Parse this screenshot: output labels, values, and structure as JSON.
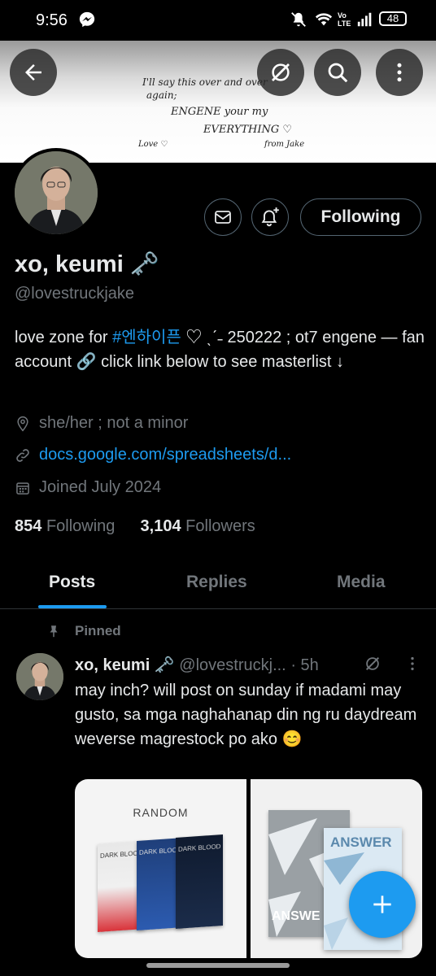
{
  "status_bar": {
    "time": "9:56",
    "battery": "48",
    "icons": [
      "messenger-icon",
      "mute-icon",
      "wifi-icon",
      "volte-icon",
      "signal-icon",
      "battery-icon"
    ]
  },
  "header": {
    "back_icon": "arrow-left-icon",
    "buttons": [
      "grok-icon",
      "search-icon",
      "more-vertical-icon"
    ]
  },
  "banner": {
    "lines": [
      "I'll say this over and over",
      "again;",
      "ENGENE   your  my",
      "EVERYTHING ♡",
      "Love ♡",
      "from Jake"
    ]
  },
  "profile": {
    "display_name": "xo, keumi",
    "name_emoji": "🗝️",
    "handle": "@lovestruckjake",
    "bio_pre": "love zone for ",
    "bio_hashtag": "#엔하이픈",
    "bio_post": " ♡ ˎˊ˗ 250222 ; ot7 engene — fan account 🔗 click link below to see masterlist ↓",
    "location": "she/her ; not a minor",
    "link": "docs.google.com/spreadsheets/d...",
    "joined": "Joined July 2024",
    "following_count": "854",
    "following_label": "Following",
    "followers_count": "3,104",
    "followers_label": "Followers",
    "following_button": "Following"
  },
  "tabs": [
    "Posts",
    "Replies",
    "Media"
  ],
  "post": {
    "pinned_label": "Pinned",
    "name": "xo, keumi",
    "name_emoji": "🗝️",
    "handle": "@lovestruckj...",
    "time": "· 5h",
    "text": "may inch? will post on sunday if madami may gusto, sa mga naghahanap din ng ru daydream weverse magrestock po ako 😊",
    "media_left_title": "RANDOM",
    "album_left_titles": [
      "DARK BLOOD",
      "DARK BLOOD",
      "DARK BLOOD"
    ],
    "album_right_title": "ANSWER",
    "album_right_title2": "ANSWE"
  },
  "colors": {
    "accent": "#1d9bf0",
    "muted": "#71767b",
    "text": "#e7e9ea",
    "border": "#536471"
  }
}
